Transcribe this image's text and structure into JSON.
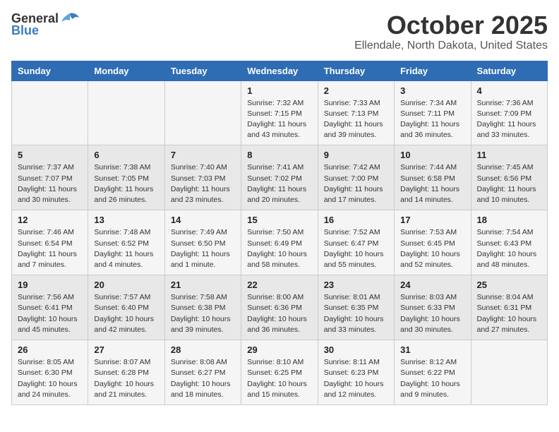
{
  "header": {
    "logo_general": "General",
    "logo_blue": "Blue",
    "month": "October 2025",
    "location": "Ellendale, North Dakota, United States"
  },
  "days_of_week": [
    "Sunday",
    "Monday",
    "Tuesday",
    "Wednesday",
    "Thursday",
    "Friday",
    "Saturday"
  ],
  "weeks": [
    [
      {
        "day": "",
        "info": ""
      },
      {
        "day": "",
        "info": ""
      },
      {
        "day": "",
        "info": ""
      },
      {
        "day": "1",
        "info": "Sunrise: 7:32 AM\nSunset: 7:15 PM\nDaylight: 11 hours\nand 43 minutes."
      },
      {
        "day": "2",
        "info": "Sunrise: 7:33 AM\nSunset: 7:13 PM\nDaylight: 11 hours\nand 39 minutes."
      },
      {
        "day": "3",
        "info": "Sunrise: 7:34 AM\nSunset: 7:11 PM\nDaylight: 11 hours\nand 36 minutes."
      },
      {
        "day": "4",
        "info": "Sunrise: 7:36 AM\nSunset: 7:09 PM\nDaylight: 11 hours\nand 33 minutes."
      }
    ],
    [
      {
        "day": "5",
        "info": "Sunrise: 7:37 AM\nSunset: 7:07 PM\nDaylight: 11 hours\nand 30 minutes."
      },
      {
        "day": "6",
        "info": "Sunrise: 7:38 AM\nSunset: 7:05 PM\nDaylight: 11 hours\nand 26 minutes."
      },
      {
        "day": "7",
        "info": "Sunrise: 7:40 AM\nSunset: 7:03 PM\nDaylight: 11 hours\nand 23 minutes."
      },
      {
        "day": "8",
        "info": "Sunrise: 7:41 AM\nSunset: 7:02 PM\nDaylight: 11 hours\nand 20 minutes."
      },
      {
        "day": "9",
        "info": "Sunrise: 7:42 AM\nSunset: 7:00 PM\nDaylight: 11 hours\nand 17 minutes."
      },
      {
        "day": "10",
        "info": "Sunrise: 7:44 AM\nSunset: 6:58 PM\nDaylight: 11 hours\nand 14 minutes."
      },
      {
        "day": "11",
        "info": "Sunrise: 7:45 AM\nSunset: 6:56 PM\nDaylight: 11 hours\nand 10 minutes."
      }
    ],
    [
      {
        "day": "12",
        "info": "Sunrise: 7:46 AM\nSunset: 6:54 PM\nDaylight: 11 hours\nand 7 minutes."
      },
      {
        "day": "13",
        "info": "Sunrise: 7:48 AM\nSunset: 6:52 PM\nDaylight: 11 hours\nand 4 minutes."
      },
      {
        "day": "14",
        "info": "Sunrise: 7:49 AM\nSunset: 6:50 PM\nDaylight: 11 hours\nand 1 minute."
      },
      {
        "day": "15",
        "info": "Sunrise: 7:50 AM\nSunset: 6:49 PM\nDaylight: 10 hours\nand 58 minutes."
      },
      {
        "day": "16",
        "info": "Sunrise: 7:52 AM\nSunset: 6:47 PM\nDaylight: 10 hours\nand 55 minutes."
      },
      {
        "day": "17",
        "info": "Sunrise: 7:53 AM\nSunset: 6:45 PM\nDaylight: 10 hours\nand 52 minutes."
      },
      {
        "day": "18",
        "info": "Sunrise: 7:54 AM\nSunset: 6:43 PM\nDaylight: 10 hours\nand 48 minutes."
      }
    ],
    [
      {
        "day": "19",
        "info": "Sunrise: 7:56 AM\nSunset: 6:41 PM\nDaylight: 10 hours\nand 45 minutes."
      },
      {
        "day": "20",
        "info": "Sunrise: 7:57 AM\nSunset: 6:40 PM\nDaylight: 10 hours\nand 42 minutes."
      },
      {
        "day": "21",
        "info": "Sunrise: 7:58 AM\nSunset: 6:38 PM\nDaylight: 10 hours\nand 39 minutes."
      },
      {
        "day": "22",
        "info": "Sunrise: 8:00 AM\nSunset: 6:36 PM\nDaylight: 10 hours\nand 36 minutes."
      },
      {
        "day": "23",
        "info": "Sunrise: 8:01 AM\nSunset: 6:35 PM\nDaylight: 10 hours\nand 33 minutes."
      },
      {
        "day": "24",
        "info": "Sunrise: 8:03 AM\nSunset: 6:33 PM\nDaylight: 10 hours\nand 30 minutes."
      },
      {
        "day": "25",
        "info": "Sunrise: 8:04 AM\nSunset: 6:31 PM\nDaylight: 10 hours\nand 27 minutes."
      }
    ],
    [
      {
        "day": "26",
        "info": "Sunrise: 8:05 AM\nSunset: 6:30 PM\nDaylight: 10 hours\nand 24 minutes."
      },
      {
        "day": "27",
        "info": "Sunrise: 8:07 AM\nSunset: 6:28 PM\nDaylight: 10 hours\nand 21 minutes."
      },
      {
        "day": "28",
        "info": "Sunrise: 8:08 AM\nSunset: 6:27 PM\nDaylight: 10 hours\nand 18 minutes."
      },
      {
        "day": "29",
        "info": "Sunrise: 8:10 AM\nSunset: 6:25 PM\nDaylight: 10 hours\nand 15 minutes."
      },
      {
        "day": "30",
        "info": "Sunrise: 8:11 AM\nSunset: 6:23 PM\nDaylight: 10 hours\nand 12 minutes."
      },
      {
        "day": "31",
        "info": "Sunrise: 8:12 AM\nSunset: 6:22 PM\nDaylight: 10 hours\nand 9 minutes."
      },
      {
        "day": "",
        "info": ""
      }
    ]
  ]
}
